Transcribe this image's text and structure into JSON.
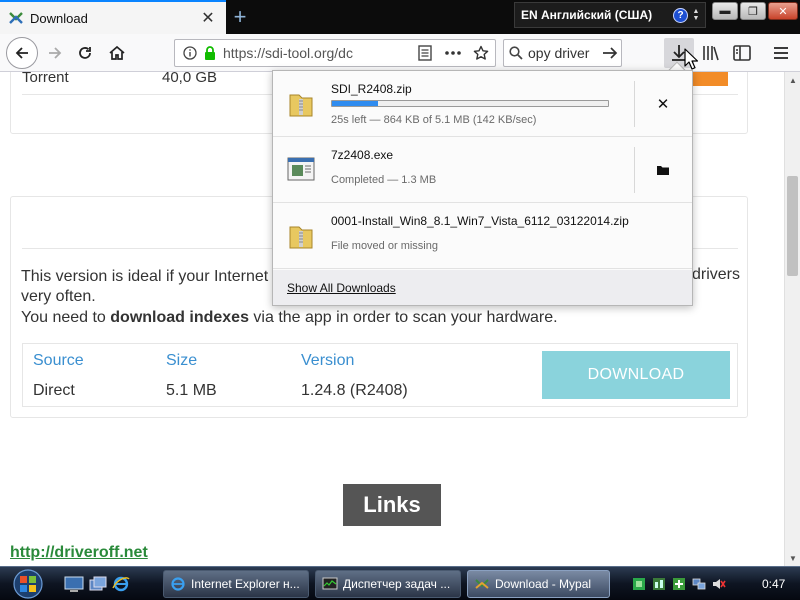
{
  "browser": {
    "tab": {
      "title": "Download",
      "close_glyph": "✕"
    },
    "new_tab_glyph": "+",
    "url": "https://sdi-tool.org/dc",
    "search_text": "opy driver",
    "icons": [
      "back-icon",
      "forward-icon",
      "reload-icon",
      "home-icon",
      "info-icon",
      "lock-icon",
      "reader-view-icon",
      "page-actions-icon",
      "bookmark-star-icon",
      "search-icon",
      "search-go-icon",
      "downloads-icon",
      "library-icon",
      "sidebar-icon",
      "hamburger-menu-icon"
    ]
  },
  "ime": {
    "text": "EN Английский (США)",
    "help_glyph": "?"
  },
  "window_controls": {
    "minimize": "▬",
    "maximize": "❐",
    "close": "✕"
  },
  "page": {
    "torrent_label": "Torrent",
    "torrent_size": "40,0 GB",
    "desc_line1": "This version is ideal if your Internet i",
    "desc_line1_end": "drivers",
    "desc_line2": "very often.",
    "desc_line3_pre": "You need to ",
    "desc_line3_bold": "download indexes",
    "desc_line3_post": " via the app in order to scan your hardware.",
    "table": {
      "headers": [
        "Source",
        "Size",
        "Version"
      ],
      "row": [
        "Direct",
        "5.1 MB",
        "1.24.8 (R2408)"
      ],
      "button": "DOWNLOAD"
    },
    "links_button": "Links",
    "link_driveroff": "http://driveroff.net"
  },
  "downloads_panel": {
    "items": [
      {
        "name": "SDI_R2408.zip",
        "status": "25s left — 864 KB of 5.1 MB (142 KB/sec)",
        "progress": 0.165,
        "action_glyph": "✕",
        "action": "cancel"
      },
      {
        "name": "7z2408.exe",
        "status": "Completed — 1.3 MB",
        "action_glyph": "▬",
        "action": "open-folder"
      },
      {
        "name": "0001-Install_Win8_8.1_Win7_Vista_6112_03122014.zip",
        "status": "File moved or missing"
      }
    ],
    "footer": "Show All Downloads"
  },
  "taskbar": {
    "tasks": [
      {
        "label": "Internet Explorer н...",
        "icon": "ie-icon"
      },
      {
        "label": "Диспетчер задач ...",
        "icon": "task-manager-icon"
      },
      {
        "label": "Download - Mypal",
        "icon": "mypal-icon"
      }
    ],
    "clock": "0:47"
  },
  "colors": {
    "accent_tab": "#0a84ff",
    "download_button": "#8ad3dc",
    "table_header": "#3a8fd0",
    "link": "#2a8a3a",
    "progress": "#2f8cf0",
    "links_button": "#555555"
  }
}
